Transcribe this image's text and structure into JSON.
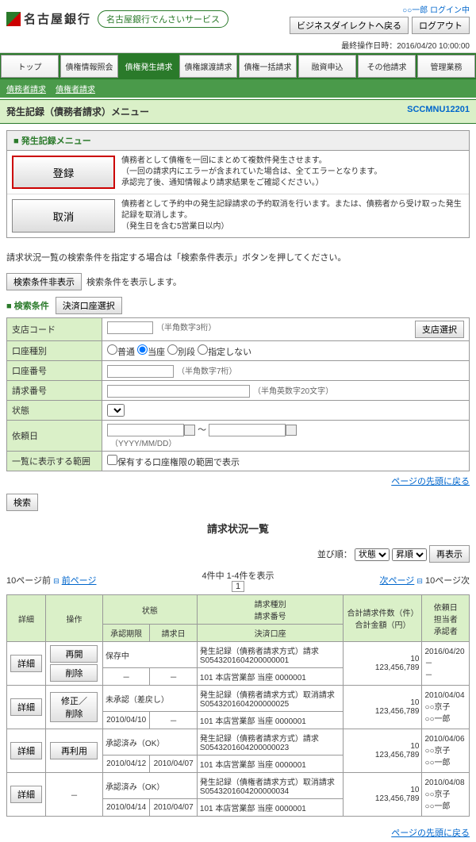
{
  "header": {
    "bank_name": "名古屋銀行",
    "service_name": "名古屋銀行でんさいサービス",
    "login_status": "○○一郎 ログイン中",
    "btn_back": "ビジネスダイレクトへ戻る",
    "btn_logout": "ログアウト",
    "timestamp_label": "最終操作日時：",
    "timestamp": "2016/04/20 10:00:00"
  },
  "tabs": [
    "トップ",
    "債権情報照会",
    "債権発生請求",
    "債権譲渡請求",
    "債権一括請求",
    "融資申込",
    "その他請求",
    "管理業務"
  ],
  "active_tab": 2,
  "sub_nav": [
    "債務者請求",
    "債権者請求"
  ],
  "page": {
    "title": "発生記録（債務者請求）メニュー",
    "code": "SCCMNU12201"
  },
  "menu": {
    "header": "発生記録メニュー",
    "items": [
      {
        "label": "登録",
        "highlight": true,
        "desc": "債務者として債権を一回にまとめて複数件発生させます。\n（一回の請求内にエラーが含まれていた場合は、全てエラーとなります。\n承認完了後、通知情報より請求結果をご確認ください。）"
      },
      {
        "label": "取消",
        "highlight": false,
        "desc": "債務者として予約中の発生記録請求の予約取消を行います。または、債務者から受け取った発生記録を取消します。\n（発生日を含む5営業日以内）"
      }
    ]
  },
  "instruction": "請求状況一覧の検索条件を指定する場合は「検索条件表示」ボタンを押してください。",
  "btn_hide_cond": "検索条件非表示",
  "hide_cond_desc": "検索条件を表示します。",
  "search": {
    "header": "検索条件",
    "btn_account": "決済口座選択",
    "rows": {
      "branch": {
        "label": "支店コード",
        "hint": "（半角数字3桁）",
        "btn": "支店選択"
      },
      "type": {
        "label": "口座種別",
        "opts": [
          "普通",
          "当座",
          "別段",
          "指定しない"
        ],
        "selected": 1
      },
      "number": {
        "label": "口座番号",
        "hint": "（半角数字7桁）"
      },
      "reqnum": {
        "label": "請求番号",
        "hint": "（半角英数字20文字）"
      },
      "status": {
        "label": "状態"
      },
      "reqdate": {
        "label": "依頼日",
        "sep": "～",
        "hint": "（YYYY/MM/DD）"
      },
      "scope": {
        "label": "一覧に表示する範囲",
        "chk": "保有する口座権限の範囲で表示"
      }
    },
    "link_top": "ページの先頭に戻る",
    "btn_search": "検索"
  },
  "list": {
    "title": "請求状況一覧",
    "sort_label": "並び順：",
    "sort1": "状態",
    "sort2": "昇順",
    "btn_refresh": "再表示",
    "count": "4件中 1-4件を表示",
    "page": "1",
    "prev10": "10ページ前",
    "prev": "前ページ",
    "next": "次ページ",
    "next10": "10ページ次",
    "cols": {
      "detail": "詳細",
      "op": "操作",
      "status": "状態",
      "app_deadline": "承認期限",
      "req_date": "請求日",
      "req_type": "請求種別\n請求番号",
      "account": "決済口座",
      "total": "合計請求件数（件）\n合計金額（円）",
      "requester": "依頼日\n担当者\n承認者"
    },
    "rows": [
      {
        "btn": "詳細",
        "ops": [
          "再開",
          "削除"
        ],
        "status": "保存中",
        "deadline": "－",
        "reqdate": "－",
        "reqtype": "発生記録（債務者請求方式）請求",
        "reqnum": "S0543201604200000001",
        "account": "101 本店営業部 当座 0000001",
        "count": "10",
        "amount": "123,456,789",
        "date": "2016/04/20",
        "person": "－",
        "approver": "－"
      },
      {
        "btn": "詳細",
        "ops": [
          "修正／削除"
        ],
        "status": "未承認（差戻し）",
        "deadline": "2010/04/10",
        "reqdate": "－",
        "reqtype": "発生記録（債務者請求方式）取消請求",
        "reqnum": "S0543201604200000025",
        "account": "101 本店営業部 当座 0000001",
        "count": "10",
        "amount": "123,456,789",
        "date": "2010/04/04",
        "person": "○○京子",
        "approver": "○○一郎"
      },
      {
        "btn": "詳細",
        "ops": [
          "再利用"
        ],
        "status": "承認済み（OK）",
        "deadline": "2010/04/12",
        "reqdate": "2010/04/07",
        "reqtype": "発生記録（債務者請求方式）請求",
        "reqnum": "S0543201604200000023",
        "account": "101 本店営業部 当座 0000001",
        "count": "10",
        "amount": "123,456,789",
        "date": "2010/04/06",
        "person": "○○京子",
        "approver": "○○一郎"
      },
      {
        "btn": "詳細",
        "ops": [],
        "opdash": "－",
        "status": "承認済み（OK）",
        "deadline": "2010/04/14",
        "reqdate": "2010/04/07",
        "reqtype": "発生記録（債権者請求方式）取消請求",
        "reqnum": "S0543201604200000034",
        "account": "101 本店営業部 当座 0000001",
        "count": "10",
        "amount": "123,456,789",
        "date": "2010/04/08",
        "person": "○○京子",
        "approver": "○○一郎"
      }
    ],
    "link_top": "ページの先頭に戻る"
  }
}
